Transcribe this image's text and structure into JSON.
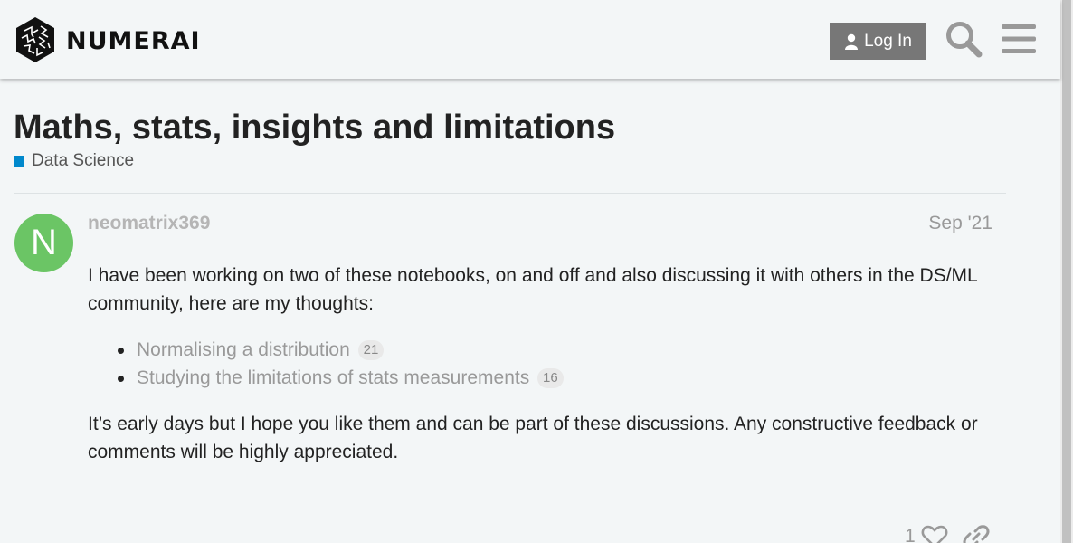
{
  "header": {
    "brand": "NUMERAI",
    "login_label": "Log In",
    "icons": {
      "logo": "numerai-logo-icon",
      "user": "user-icon",
      "search": "search-icon",
      "menu": "hamburger-menu-icon"
    }
  },
  "topic": {
    "title": "Maths, stats, insights and limitations",
    "category": "Data Science",
    "category_color": "#0088cc"
  },
  "post": {
    "avatar_letter": "N",
    "avatar_color": "#6bc565",
    "username": "neomatrix369",
    "date": "Sep '21",
    "intro": "I have been working on two of these notebooks, on and off and also discussing it with others in the DS/ML community, here are my thoughts:",
    "links": [
      {
        "label": "Normalising a distribution",
        "clicks": "21"
      },
      {
        "label": "Studying the limitations of stats measurements",
        "clicks": "16"
      }
    ],
    "outro": "It’s early days but I hope you like them and can be part of these discussions. Any constructive feedback or comments will be highly appreciated.",
    "like_count": "1",
    "icons": {
      "like": "heart-icon",
      "share": "link-icon"
    }
  }
}
